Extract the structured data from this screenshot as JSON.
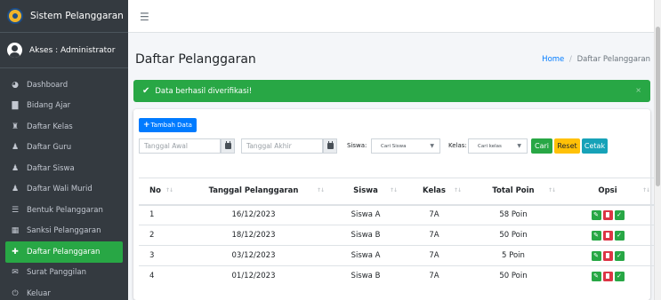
{
  "app": {
    "brand": "Sistem Pelanggaran"
  },
  "user": {
    "access": "Akses : Administrator"
  },
  "sidebar": {
    "items": [
      {
        "label": "Dashboard",
        "icon": "dashboard-icon"
      },
      {
        "label": "Bidang Ajar",
        "icon": "book-icon"
      },
      {
        "label": "Daftar Kelas",
        "icon": "classroom-icon"
      },
      {
        "label": "Daftar Guru",
        "icon": "users-icon"
      },
      {
        "label": "Daftar Siswa",
        "icon": "users-icon"
      },
      {
        "label": "Daftar Wali Murid",
        "icon": "users-icon"
      },
      {
        "label": "Bentuk Pelanggaran",
        "icon": "list-icon"
      },
      {
        "label": "Sanksi Pelanggaran",
        "icon": "table-icon"
      },
      {
        "label": "Daftar Pelanggaran",
        "icon": "plus-icon",
        "active": true
      },
      {
        "label": "Surat Panggilan",
        "icon": "mail-icon"
      },
      {
        "label": "Keluar",
        "icon": "power-icon"
      }
    ]
  },
  "page": {
    "title": "Daftar Pelanggaran",
    "breadcrumb_home": "Home",
    "breadcrumb_sep": "/",
    "breadcrumb_current": "Daftar Pelanggaran"
  },
  "alert": {
    "message": "Data berhasil diverifikasi!",
    "close": "×"
  },
  "toolbar": {
    "add_label": "Tambah Data"
  },
  "filters": {
    "start_placeholder": "Tanggal Awal",
    "end_placeholder": "Tanggal Akhir",
    "siswa_label": "Siswa:",
    "siswa_value": "Cari Siswa",
    "kelas_label": "Kelas:",
    "kelas_value": "Cari kelas",
    "cari_label": "Cari",
    "reset_label": "Reset",
    "cetak_label": "Cetak"
  },
  "table": {
    "headers": [
      "No",
      "Tanggal Pelanggaran",
      "Siswa",
      "Kelas",
      "Total Poin",
      "Opsi"
    ],
    "rows": [
      {
        "no": "1",
        "tanggal": "16/12/2023",
        "siswa": "Siswa A",
        "kelas": "7A",
        "poin": "58 Poin"
      },
      {
        "no": "2",
        "tanggal": "18/12/2023",
        "siswa": "Siswa B",
        "kelas": "7A",
        "poin": "50 Poin"
      },
      {
        "no": "3",
        "tanggal": "03/12/2023",
        "siswa": "Siswa A",
        "kelas": "7A",
        "poin": "5 Poin"
      },
      {
        "no": "4",
        "tanggal": "01/12/2023",
        "siswa": "Siswa B",
        "kelas": "7A",
        "poin": "50 Poin"
      }
    ]
  },
  "colors": {
    "sidebar": "#343a40",
    "success": "#28a745",
    "primary": "#007bff",
    "warning": "#ffc107",
    "info": "#17a2b8",
    "danger": "#dc3545"
  }
}
